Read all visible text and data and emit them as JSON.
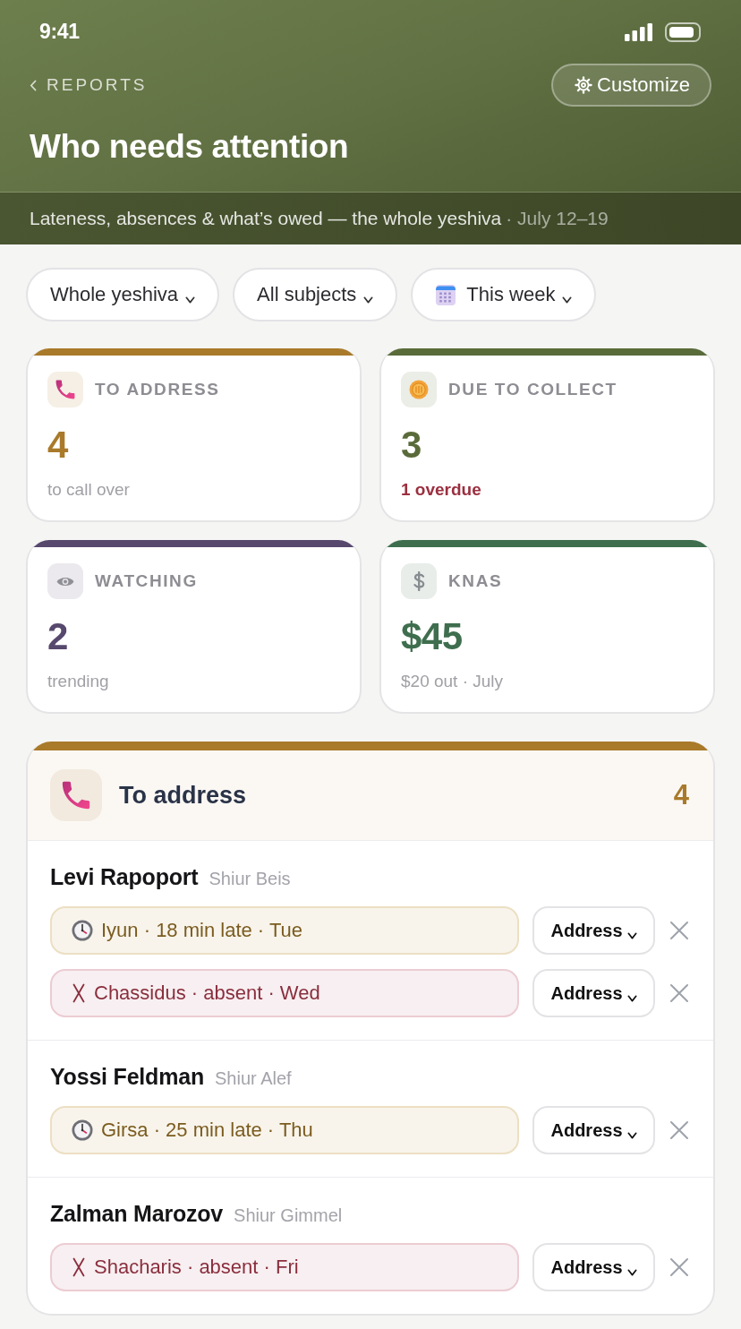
{
  "status_bar": {
    "time": "9:41"
  },
  "nav": {
    "back": "REPORTS",
    "action": "Customize"
  },
  "title": "Who needs attention",
  "subtitle": {
    "text": "Lateness, absences & what’s owed — the whole yeshiva",
    "date": "· July 12–19"
  },
  "filters": [
    {
      "label": "Whole yeshiva",
      "kind": "scope"
    },
    {
      "label": "All subjects",
      "kind": "subject"
    },
    {
      "label": "This week",
      "kind": "date"
    }
  ],
  "stats": [
    {
      "kind": "address",
      "label": "TO ADDRESS",
      "value": "4",
      "note": "to call over",
      "note_alert": false,
      "color": "#a97a2a"
    },
    {
      "kind": "collect",
      "label": "DUE TO COLLECT",
      "value": "3",
      "note": "1 overdue",
      "note_alert": true,
      "color": "#5a6b3a"
    },
    {
      "kind": "watch",
      "label": "WATCHING",
      "value": "2",
      "note": "trending",
      "note_alert": false,
      "color": "#57486d"
    },
    {
      "kind": "fines",
      "label": "KNAS",
      "value": "$45",
      "note": "$20 out · July",
      "note_alert": false,
      "color": "#3e6e4e"
    }
  ],
  "section": {
    "kind": "address",
    "title": "To address",
    "count": "4",
    "color": "#a97a2a",
    "people": [
      {
        "name": "Levi Rapoport",
        "group": "Shiur Beis",
        "items": [
          {
            "kind": "late",
            "text": "Iyun · 18 min late · Tue",
            "action": "Address"
          },
          {
            "kind": "absent",
            "text": "Chassidus · absent · Wed",
            "action": "Address"
          }
        ]
      },
      {
        "name": "Yossi Feldman",
        "group": "Shiur Alef",
        "items": [
          {
            "kind": "late",
            "text": "Girsa · 25 min late · Thu",
            "action": "Address"
          }
        ]
      },
      {
        "name": "Zalman Marozov",
        "group": "Shiur Gimmel",
        "items": [
          {
            "kind": "absent",
            "text": "Shacharis · absent · Fri",
            "action": "Address"
          }
        ]
      }
    ]
  }
}
